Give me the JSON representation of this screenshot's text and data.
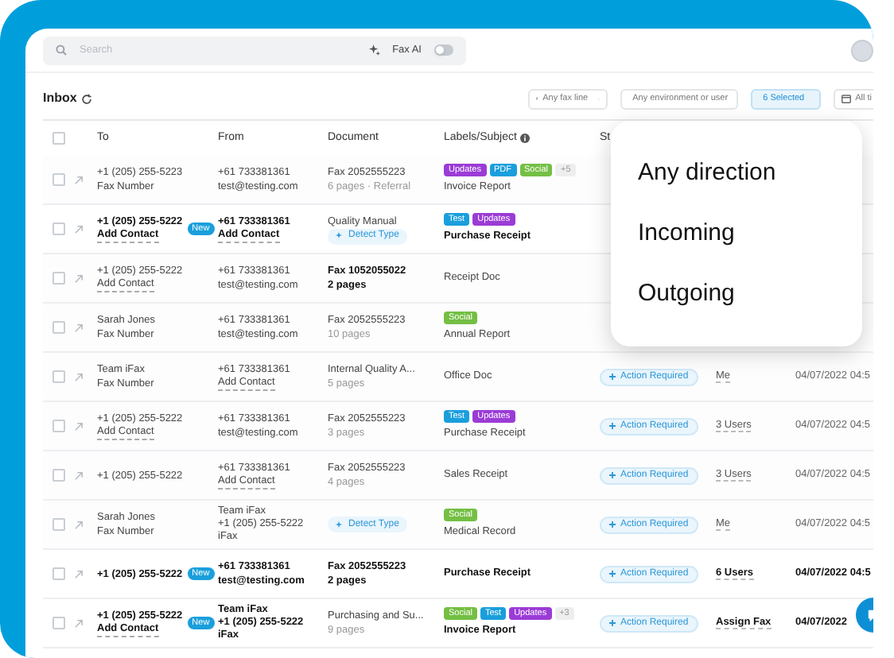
{
  "search": {
    "placeholder": "Search",
    "ai_label": "Fax AI",
    "ai_on": false
  },
  "toolbar": {
    "title": "Inbox",
    "filters": [
      {
        "kind": "line",
        "label": "Any fax line",
        "selected": false
      },
      {
        "kind": "user",
        "label": "Any environment or user",
        "selected": false
      },
      {
        "kind": "direction",
        "label": "6 Selected",
        "selected": true
      },
      {
        "kind": "time",
        "label": "All ti",
        "selected": false
      }
    ]
  },
  "table": {
    "all_checked": false,
    "columns": [
      "To",
      "From",
      "Document",
      "Labels/Subject",
      "St"
    ],
    "rows": [
      {
        "checked": false,
        "unread": false,
        "to": {
          "new": false,
          "lines": [
            {
              "text": "+1 (205) 255-5223",
              "link": false
            },
            {
              "text": "Fax Number",
              "link": false
            }
          ]
        },
        "from": [
          {
            "text": "+61 733381361",
            "link": false
          },
          {
            "text": "test@testing.com",
            "link": false
          }
        ],
        "document": {
          "title": "Fax 2052555223",
          "detail": "6 pages · Referral",
          "bold": false
        },
        "labels": [
          {
            "text": "Updates",
            "color": "#9b3bd6"
          },
          {
            "text": "PDF",
            "color": "#1a9fdc"
          },
          {
            "text": "Social",
            "color": "#74bf44"
          },
          {
            "text": "+5",
            "color": "#eeeeee"
          }
        ],
        "subject": "Invoice Report"
      },
      {
        "checked": false,
        "unread": true,
        "to": {
          "new": true,
          "new_label": "New",
          "lines": [
            {
              "text": "+1 (205) 255-5222",
              "link": false
            },
            {
              "text": "Add Contact",
              "link": true
            }
          ]
        },
        "from": [
          {
            "text": "+61 733381361",
            "link": false
          },
          {
            "text": "Add Contact",
            "link": true
          }
        ],
        "document": {
          "title": "Quality Manual",
          "detect": "Detect Type",
          "bold": false
        },
        "labels": [
          {
            "text": "Test",
            "color": "#1a9fdc"
          },
          {
            "text": "Updates",
            "color": "#9b3bd6"
          }
        ],
        "subject": "Purchase Receipt"
      },
      {
        "checked": false,
        "unread": false,
        "to": {
          "new": false,
          "lines": [
            {
              "text": "+1 (205) 255-5222",
              "link": false
            },
            {
              "text": "Add Contact",
              "link": true
            }
          ]
        },
        "from": [
          {
            "text": "+61 733381361",
            "link": false
          },
          {
            "text": "test@testing.com",
            "link": false
          }
        ],
        "document": {
          "title": "Fax 1052055022",
          "detail": "2 pages",
          "bold": true
        },
        "labels": [],
        "subject": "Receipt Doc"
      },
      {
        "checked": false,
        "unread": false,
        "to": {
          "new": false,
          "lines": [
            {
              "text": "Sarah Jones",
              "link": false
            },
            {
              "text": "Fax Number",
              "link": false
            }
          ]
        },
        "from": [
          {
            "text": "+61 733381361",
            "link": false
          },
          {
            "text": "test@testing.com",
            "link": false
          }
        ],
        "document": {
          "title": "Fax 2052555223",
          "detail": "10 pages",
          "bold": false
        },
        "labels": [
          {
            "text": "Social",
            "color": "#74bf44"
          }
        ],
        "subject": "Annual Report"
      },
      {
        "checked": false,
        "unread": false,
        "to": {
          "new": false,
          "lines": [
            {
              "text": "Team iFax",
              "link": false
            },
            {
              "text": "Fax Number",
              "link": false
            }
          ]
        },
        "from": [
          {
            "text": "+61 733381361",
            "link": false
          },
          {
            "text": "Add Contact",
            "link": true
          }
        ],
        "document": {
          "title": "Internal Quality A...",
          "detail": "5 pages",
          "bold": false
        },
        "labels": [],
        "subject": "Office Doc",
        "status": "Action Required",
        "assigned": "Me",
        "updated": "04/07/2022 04:5"
      },
      {
        "checked": false,
        "unread": false,
        "to": {
          "new": false,
          "lines": [
            {
              "text": "+1 (205) 255-5222",
              "link": false
            },
            {
              "text": "Add Contact",
              "link": true
            }
          ]
        },
        "from": [
          {
            "text": "+61 733381361",
            "link": false
          },
          {
            "text": "test@testing.com",
            "link": false
          }
        ],
        "document": {
          "title": "Fax 2052555223",
          "detail": "3 pages",
          "bold": false
        },
        "labels": [
          {
            "text": "Test",
            "color": "#1a9fdc"
          },
          {
            "text": "Updates",
            "color": "#9b3bd6"
          }
        ],
        "subject": "Purchase Receipt",
        "status": "Action Required",
        "assigned": "3 Users",
        "updated": "04/07/2022 04:5"
      },
      {
        "checked": false,
        "unread": false,
        "to": {
          "new": false,
          "lines": [
            {
              "text": "+1 (205) 255-5222",
              "link": false
            }
          ]
        },
        "from": [
          {
            "text": "+61 733381361",
            "link": false
          },
          {
            "text": "Add Contact",
            "link": true
          }
        ],
        "document": {
          "title": "Fax 2052555223",
          "detail": "4 pages",
          "bold": false
        },
        "labels": [],
        "subject": "Sales Receipt",
        "status": "Action Required",
        "assigned": "3 Users",
        "updated": "04/07/2022 04:5"
      },
      {
        "checked": false,
        "unread": false,
        "to": {
          "new": false,
          "lines": [
            {
              "text": "Sarah Jones",
              "link": false
            },
            {
              "text": "Fax Number",
              "link": false
            }
          ]
        },
        "from": [
          {
            "text": "Team iFax",
            "link": false
          },
          {
            "text": "+1 (205) 255-5222",
            "link": false
          },
          {
            "text": "iFax",
            "link": false
          }
        ],
        "document": {
          "detect": "Detect Type"
        },
        "labels": [
          {
            "text": "Social",
            "color": "#74bf44"
          }
        ],
        "subject": "Medical Record",
        "status": "Action Required",
        "assigned": "Me",
        "updated": "04/07/2022 04:5"
      },
      {
        "checked": false,
        "unread": true,
        "to": {
          "new": true,
          "new_label": "New",
          "lines": [
            {
              "text": "+1 (205) 255-5222",
              "link": false
            }
          ]
        },
        "from": [
          {
            "text": "+61 733381361",
            "link": false
          },
          {
            "text": "test@testing.com",
            "link": false
          }
        ],
        "document": {
          "title": "Fax 2052555223",
          "detail": "2 pages",
          "bold": true
        },
        "labels": [],
        "subject": "Purchase Receipt",
        "status": "Action Required",
        "assigned": "6 Users",
        "updated": "04/07/2022 04:5"
      },
      {
        "checked": false,
        "unread": true,
        "to": {
          "new": true,
          "new_label": "New",
          "lines": [
            {
              "text": "+1 (205) 255-5222",
              "link": false
            },
            {
              "text": "Add Contact",
              "link": true
            }
          ]
        },
        "from": [
          {
            "text": "Team iFax",
            "link": false
          },
          {
            "text": "+1 (205) 255-5222",
            "link": false
          },
          {
            "text": "iFax",
            "link": false
          }
        ],
        "document": {
          "title": "Purchasing and Su...",
          "detail": "9 pages",
          "bold": false
        },
        "labels": [
          {
            "text": "Social",
            "color": "#74bf44"
          },
          {
            "text": "Test",
            "color": "#1a9fdc"
          },
          {
            "text": "Updates",
            "color": "#9b3bd6"
          },
          {
            "text": "+3",
            "color": "#eeeeee"
          }
        ],
        "subject": "Invoice Report",
        "status": "Action Required",
        "assigned": "Assign Fax",
        "updated": "04/07/2022"
      }
    ]
  },
  "direction_menu": {
    "items": [
      "Any direction",
      "Incoming",
      "Outgoing"
    ]
  }
}
